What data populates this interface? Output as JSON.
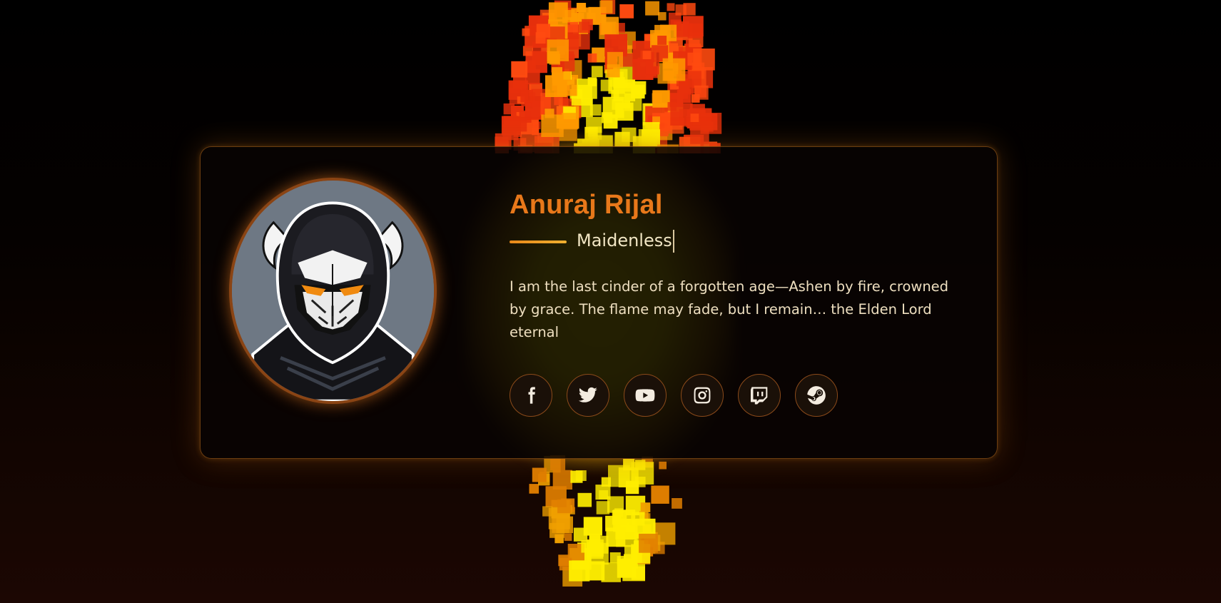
{
  "profile": {
    "name": "Anuraj Rijal",
    "subtitle": "Maidenless",
    "bio": "I am the last cinder of a forgotten age—Ashen by fire, crowned by grace. The flame may fade, but I remain… the Elden Lord eternal",
    "avatar_icon": "horned-ninja-avatar"
  },
  "socials": [
    {
      "icon": "facebook-icon"
    },
    {
      "icon": "twitter-icon"
    },
    {
      "icon": "youtube-icon"
    },
    {
      "icon": "instagram-icon"
    },
    {
      "icon": "twitch-icon"
    },
    {
      "icon": "steam-icon"
    }
  ],
  "colors": {
    "accent": "#e8781a",
    "card_border": "#8a4414",
    "fire_red": "#ff3a10",
    "fire_orange": "#ff8a00",
    "fire_yellow": "#ffff00",
    "text": "#eedfc0"
  }
}
